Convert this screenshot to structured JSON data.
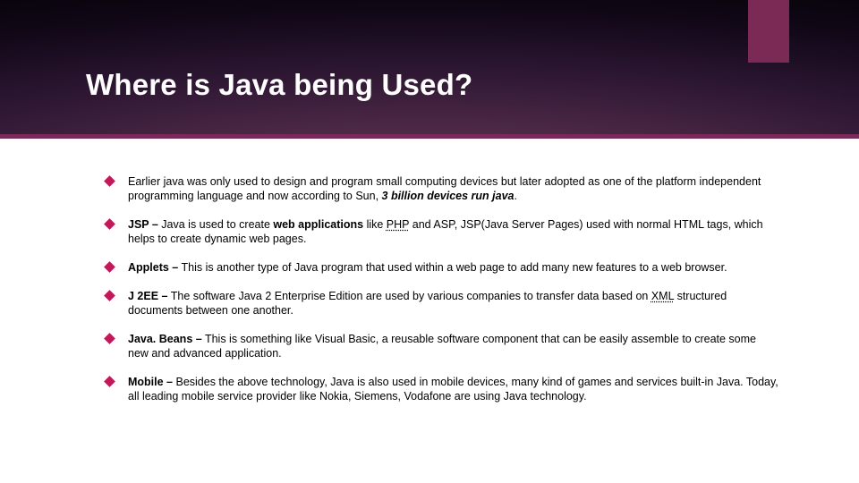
{
  "title": "Where is Java being Used?",
  "bullets": [
    {
      "html": "Earlier java was only used to design and program small computing devices but later adopted as one of the platform independent programming language and now according to Sun, <b><i>3 billion devices run java</i></b>."
    },
    {
      "html": "<b>JSP –</b> Java is used to create <b>web applications</b> like <span class='link'>PHP</span> and ASP, JSP(Java Server Pages) used with normal HTML tags, which helps to create dynamic web pages."
    },
    {
      "html": "<b>Applets –</b> This is another type of Java program that used within a web page to add many new features to a web browser."
    },
    {
      "html": "<b>J 2EE –</b> The software Java 2 Enterprise Edition are used by various companies to transfer data based on <span class='link'>XML</span> structured documents between one another."
    },
    {
      "html": "<b>Java. Beans –</b> This is something like Visual Basic, a reusable software component that can be easily assemble to create some new and advanced application."
    },
    {
      "html": "<b>Mobile –</b> Besides the above technology, Java is also used in mobile devices, many kind of games and services built-in Java. Today, all leading mobile service provider like Nokia, Siemens, Vodafone are using Java technology."
    }
  ]
}
